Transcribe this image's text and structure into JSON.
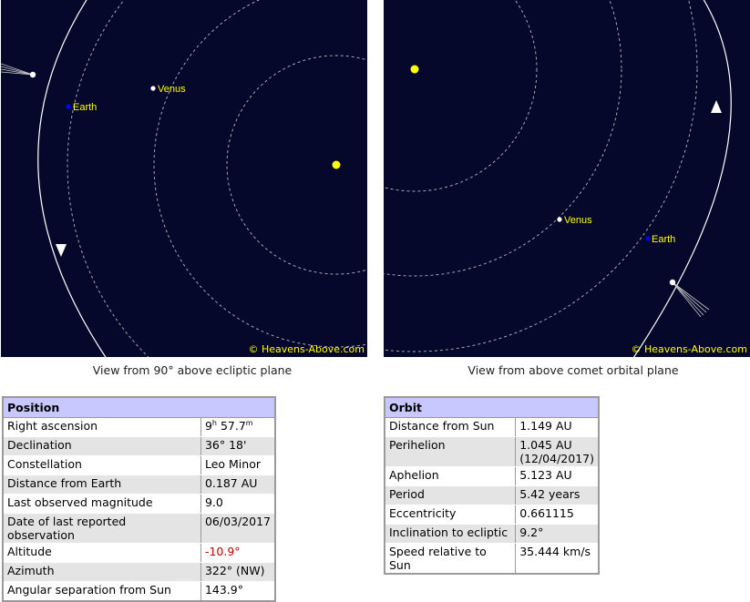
{
  "views": {
    "left": {
      "caption": "View from 90° above ecliptic plane",
      "credit": "© Heavens-Above.com",
      "labels": {
        "venus": "Venus",
        "earth": "Earth"
      }
    },
    "right": {
      "caption": "View from above comet orbital plane",
      "credit": "© Heavens-Above.com",
      "labels": {
        "venus": "Venus",
        "earth": "Earth"
      }
    }
  },
  "colors": {
    "sky": "#05082a",
    "sun": "#ffff00",
    "earth": "#0000ff",
    "label": "#ffff00",
    "orbit": "#b8b8b8",
    "header": "#c8c8ff",
    "negative": "#c00000"
  },
  "position": {
    "title": "Position",
    "rows": {
      "right_ascension": {
        "label": "Right ascension",
        "h": "9",
        "h_unit": "h",
        "m": " 57.7",
        "m_unit": "m"
      },
      "declination": {
        "label": "Declination",
        "value": "36° 18'"
      },
      "constellation": {
        "label": "Constellation",
        "value": "Leo Minor"
      },
      "distance_earth": {
        "label": "Distance from Earth",
        "value": "0.187 AU"
      },
      "magnitude": {
        "label": "Last observed magnitude",
        "value": "9.0"
      },
      "last_obs": {
        "label": "Date of last reported observation",
        "value": "06/03/2017"
      },
      "altitude": {
        "label": "Altitude",
        "value": "-10.9°"
      },
      "azimuth": {
        "label": "Azimuth",
        "value": "322° (NW)"
      },
      "angular_sep": {
        "label": "Angular separation from Sun",
        "value": "143.9°"
      }
    }
  },
  "orbit": {
    "title": "Orbit",
    "rows": {
      "distance_sun": {
        "label": "Distance from Sun",
        "value": "1.149 AU"
      },
      "perihelion": {
        "label": "Perihelion",
        "value": "1.045 AU",
        "date": "(12/04/2017)"
      },
      "aphelion": {
        "label": "Aphelion",
        "value": "5.123 AU"
      },
      "period": {
        "label": "Period",
        "value": "5.42 years"
      },
      "eccentricity": {
        "label": "Eccentricity",
        "value": "0.661115"
      },
      "inclination": {
        "label": "Inclination to ecliptic",
        "value": "9.2°"
      },
      "speed": {
        "label": "Speed relative to Sun",
        "value": "35.444 km/s"
      }
    }
  }
}
